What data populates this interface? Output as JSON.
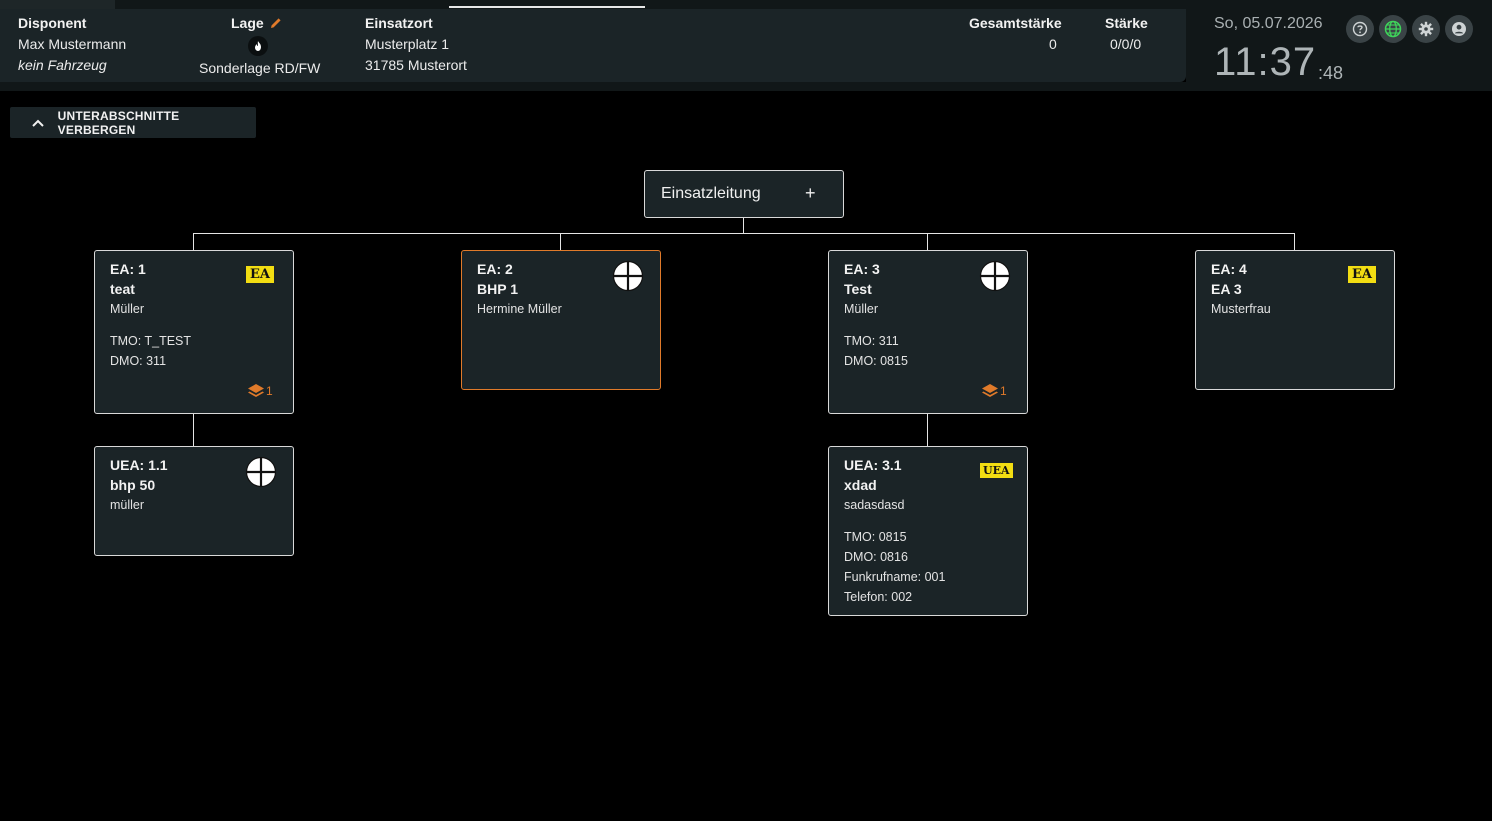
{
  "header": {
    "disponent_label": "Disponent",
    "disponent_name": "Max Mustermann",
    "disponent_vehicle": "kein Fahrzeug",
    "lage_label": "Lage",
    "lage_value": "Sonderlage RD/FW",
    "einsatzort_label": "Einsatzort",
    "einsatzort_street": "Musterplatz 1",
    "einsatzort_city": "31785 Musterort",
    "gesamtstaerke_label": "Gesamtstärke",
    "gesamtstaerke_value": "0",
    "staerke_label": "Stärke",
    "staerke_value": "0/0/0"
  },
  "clock": {
    "date": "So, 05.07.2026",
    "time": "11:37",
    "seconds": ":48"
  },
  "toolbar": {
    "toggle_label": "UNTERABSCHNITTE VERBERGEN"
  },
  "root": {
    "label": "Einsatzleitung",
    "add_symbol": "+"
  },
  "cards": {
    "ea1": {
      "id": "EA: 1",
      "name": "teat",
      "person": "Müller",
      "tmo": "TMO: T_TEST",
      "dmo": "DMO: 311",
      "badge": "EA",
      "layers": "1"
    },
    "ea2": {
      "id": "EA: 2",
      "name": "BHP 1",
      "person": "Hermine Müller"
    },
    "ea3": {
      "id": "EA: 3",
      "name": "Test",
      "person": "Müller",
      "tmo": "TMO: 311",
      "dmo": "DMO: 0815",
      "layers": "1"
    },
    "ea4": {
      "id": "EA: 4",
      "name": "EA 3",
      "person": "Musterfrau",
      "badge": "EA"
    },
    "uea11": {
      "id": "UEA: 1.1",
      "name": "bhp 50",
      "person": "müller"
    },
    "uea31": {
      "id": "UEA: 3.1",
      "name": "xdad",
      "person": "sadasdasd",
      "tmo": "TMO: 0815",
      "dmo": "DMO: 0816",
      "funkruf": "Funkrufname: 001",
      "telefon": "Telefon: 002",
      "badge": "UEA"
    }
  },
  "colors": {
    "background": "#000000",
    "panel": "#1b2427",
    "accent_orange": "#e07a2a",
    "badge_yellow": "#f2dd12"
  }
}
